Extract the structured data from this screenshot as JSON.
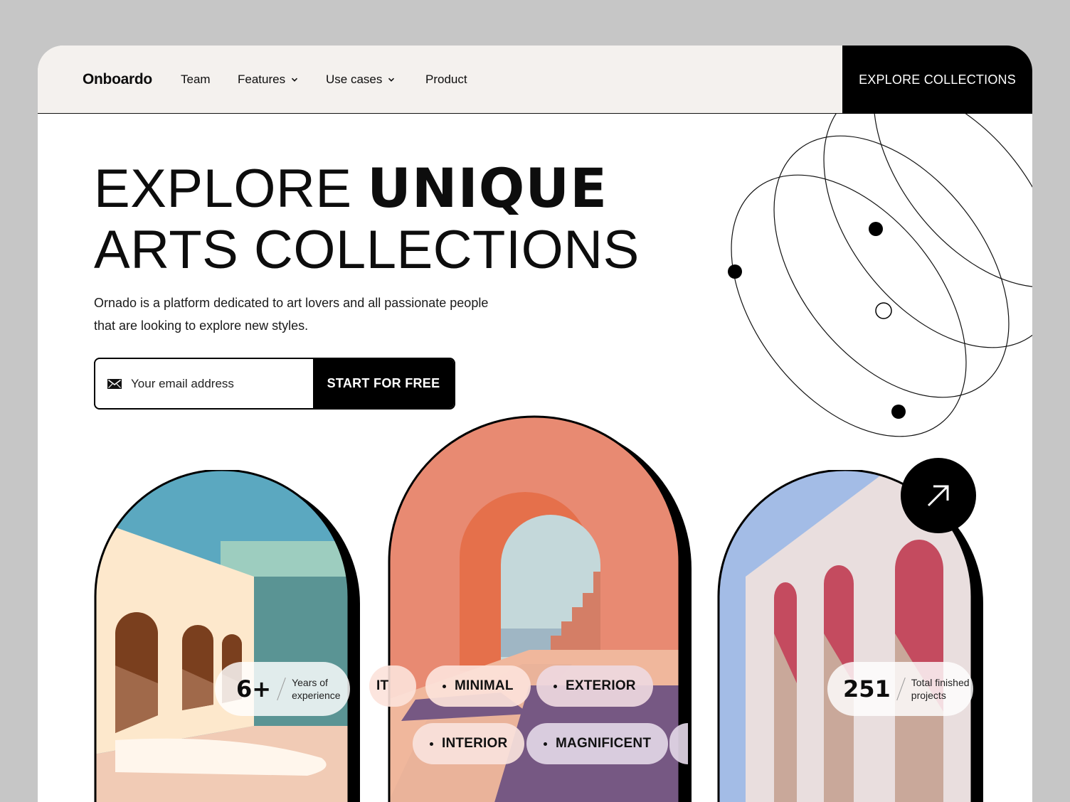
{
  "nav": {
    "logo": "Onboardo",
    "items": [
      {
        "label": "Team"
      },
      {
        "label": "Features"
      },
      {
        "label": "Use cases"
      },
      {
        "label": "Product"
      }
    ],
    "cta": "EXPLORE COLLECTIONS"
  },
  "hero": {
    "title_line1_light": "EXPLORE ",
    "title_line1_bold": "UNIQUE",
    "title_line2": "ARTS COLLECTIONS",
    "subtitle": "Ornado is a platform dedicated to art lovers and all passionate people that are looking to explore new styles.",
    "email_placeholder": "Your email address",
    "start_button": "START FOR FREE"
  },
  "stats": [
    {
      "value": "6+",
      "label_line1": "Years of",
      "label_line2": "experience"
    },
    {
      "value": "251",
      "label_line1": "Total finished",
      "label_line2": "projects"
    }
  ],
  "tags": {
    "row1": [
      "IT",
      "MINIMAL",
      "EXTERIOR"
    ],
    "row2": [
      "INTERIOR",
      "MAGNIFICENT"
    ]
  },
  "colors": {
    "nav_bg": "#f4f1ee",
    "accent": "#000000",
    "arch_left_sky": "#5ba8c0",
    "arch_center_bg": "#e88a72",
    "arch_right_bg": "#e9dede"
  },
  "icons": [
    "chevron-down-icon",
    "mail-icon",
    "arrow-up-right-icon"
  ]
}
